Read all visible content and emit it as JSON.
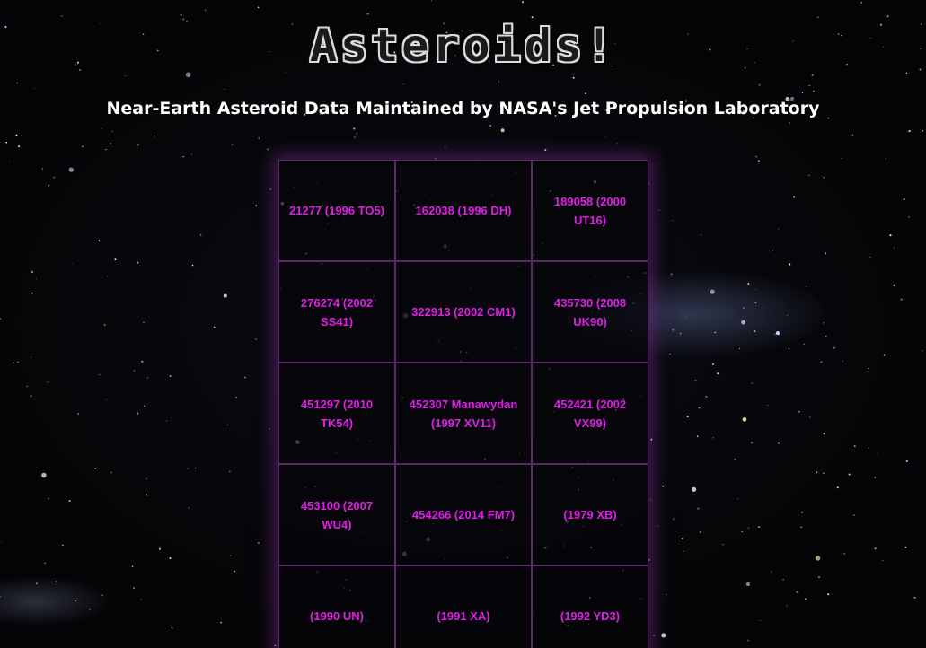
{
  "page": {
    "title": "Asteroids!",
    "subtitle": "Near-Earth Asteroid Data Maintained by NASA's Jet Propulsion Laboratory"
  },
  "asteroids": [
    "21277 (1996 TO5)",
    "162038 (1996 DH)",
    "189058 (2000 UT16)",
    "276274 (2002 SS41)",
    "322913 (2002 CM1)",
    "435730 (2008 UK90)",
    "451297 (2010 TK54)",
    "452307 Manawydan (1997 XV11)",
    "452421 (2002 VX99)",
    "453100 (2007 WU4)",
    "454266 (2014 FM7)",
    "(1979 XB)",
    "(1990 UN)",
    "(1991 XA)",
    "(1992 YD3)"
  ],
  "colors": {
    "accent": "#e01ee8",
    "cell_border": "#5a2a66",
    "background": "#07070b"
  }
}
